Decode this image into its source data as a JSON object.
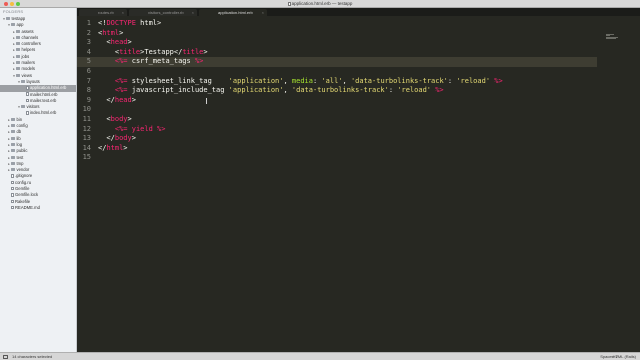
{
  "window": {
    "title": "application.html.erb — testapp"
  },
  "sidebar": {
    "header": "FOLDERS",
    "items": [
      {
        "label": "testapp",
        "depth": 0,
        "type": "folder",
        "expanded": true
      },
      {
        "label": "app",
        "depth": 1,
        "type": "folder",
        "expanded": true
      },
      {
        "label": "assets",
        "depth": 2,
        "type": "folder",
        "expanded": false
      },
      {
        "label": "channels",
        "depth": 2,
        "type": "folder",
        "expanded": false
      },
      {
        "label": "controllers",
        "depth": 2,
        "type": "folder",
        "expanded": false
      },
      {
        "label": "helpers",
        "depth": 2,
        "type": "folder",
        "expanded": false
      },
      {
        "label": "jobs",
        "depth": 2,
        "type": "folder",
        "expanded": false
      },
      {
        "label": "mailers",
        "depth": 2,
        "type": "folder",
        "expanded": false
      },
      {
        "label": "models",
        "depth": 2,
        "type": "folder",
        "expanded": false
      },
      {
        "label": "views",
        "depth": 2,
        "type": "folder",
        "expanded": true
      },
      {
        "label": "layouts",
        "depth": 3,
        "type": "folder",
        "expanded": true
      },
      {
        "label": "application.html.erb",
        "depth": 4,
        "type": "file",
        "selected": true
      },
      {
        "label": "mailer.html.erb",
        "depth": 4,
        "type": "file"
      },
      {
        "label": "mailer.text.erb",
        "depth": 4,
        "type": "file"
      },
      {
        "label": "visitors",
        "depth": 3,
        "type": "folder",
        "expanded": true
      },
      {
        "label": "index.html.erb",
        "depth": 4,
        "type": "file"
      },
      {
        "label": "bin",
        "depth": 1,
        "type": "folder",
        "expanded": false
      },
      {
        "label": "config",
        "depth": 1,
        "type": "folder",
        "expanded": false
      },
      {
        "label": "db",
        "depth": 1,
        "type": "folder",
        "expanded": false
      },
      {
        "label": "lib",
        "depth": 1,
        "type": "folder",
        "expanded": false
      },
      {
        "label": "log",
        "depth": 1,
        "type": "folder",
        "expanded": false
      },
      {
        "label": "public",
        "depth": 1,
        "type": "folder",
        "expanded": false
      },
      {
        "label": "test",
        "depth": 1,
        "type": "folder",
        "expanded": false
      },
      {
        "label": "tmp",
        "depth": 1,
        "type": "folder",
        "expanded": false
      },
      {
        "label": "vendor",
        "depth": 1,
        "type": "folder",
        "expanded": false
      },
      {
        "label": ".gitignore",
        "depth": 1,
        "type": "file"
      },
      {
        "label": "config.ru",
        "depth": 1,
        "type": "file"
      },
      {
        "label": "Gemfile",
        "depth": 1,
        "type": "file"
      },
      {
        "label": "Gemfile.lock",
        "depth": 1,
        "type": "file"
      },
      {
        "label": "Rakefile",
        "depth": 1,
        "type": "file"
      },
      {
        "label": "README.md",
        "depth": 1,
        "type": "file"
      }
    ]
  },
  "tabs": [
    {
      "label": "routes.rb",
      "active": false
    },
    {
      "label": "visitors_controller.rb",
      "active": false
    },
    {
      "label": "application.html.erb",
      "active": true
    }
  ],
  "editor": {
    "current_line": 5,
    "lines": [
      [
        [
          "pu",
          "<!"
        ],
        [
          "tg",
          "DOCTYPE"
        ],
        [
          "pu",
          " html>"
        ]
      ],
      [
        [
          "pu",
          "<"
        ],
        [
          "tg",
          "html"
        ],
        [
          "pu",
          ">"
        ]
      ],
      [
        [
          "pu",
          "  <"
        ],
        [
          "tg",
          "head"
        ],
        [
          "pu",
          ">"
        ]
      ],
      [
        [
          "pu",
          "    <"
        ],
        [
          "tg",
          "title"
        ],
        [
          "pu",
          ">Testapp</"
        ],
        [
          "tg",
          "title"
        ],
        [
          "pu",
          ">"
        ]
      ],
      [
        [
          "pu",
          "    "
        ],
        [
          "tg",
          "<%="
        ],
        [
          "pu",
          " csrf_meta_tags "
        ],
        [
          "tg",
          "%>"
        ]
      ],
      [],
      [
        [
          "pu",
          "    "
        ],
        [
          "tg",
          "<%="
        ],
        [
          "pu",
          " stylesheet_link_tag    "
        ],
        [
          "st",
          "'application'"
        ],
        [
          "pu",
          ", "
        ],
        [
          "kw",
          "media"
        ],
        [
          "pu",
          ": "
        ],
        [
          "st",
          "'all'"
        ],
        [
          "pu",
          ", "
        ],
        [
          "st",
          "'data-turbolinks-track'"
        ],
        [
          "pu",
          ": "
        ],
        [
          "st",
          "'reload'"
        ],
        [
          "pu",
          " "
        ],
        [
          "tg",
          "%>"
        ]
      ],
      [
        [
          "pu",
          "    "
        ],
        [
          "tg",
          "<%="
        ],
        [
          "pu",
          " javascript_include_tag "
        ],
        [
          "st",
          "'application'"
        ],
        [
          "pu",
          ", "
        ],
        [
          "st",
          "'data-turbolinks-track'"
        ],
        [
          "pu",
          ": "
        ],
        [
          "st",
          "'reload'"
        ],
        [
          "pu",
          " "
        ],
        [
          "tg",
          "%>"
        ]
      ],
      [
        [
          "pu",
          "  </"
        ],
        [
          "tg",
          "head"
        ],
        [
          "pu",
          ">"
        ]
      ],
      [],
      [
        [
          "pu",
          "  <"
        ],
        [
          "tg",
          "body"
        ],
        [
          "pu",
          ">"
        ]
      ],
      [
        [
          "pu",
          "    "
        ],
        [
          "tg",
          "<%="
        ],
        [
          "pu",
          " "
        ],
        [
          "tg",
          "yield"
        ],
        [
          "pu",
          " "
        ],
        [
          "tg",
          "%>"
        ]
      ],
      [
        [
          "pu",
          "  </"
        ],
        [
          "tg",
          "body"
        ],
        [
          "pu",
          ">"
        ]
      ],
      [
        [
          "pu",
          "</"
        ],
        [
          "tg",
          "html"
        ],
        [
          "pu",
          ">"
        ]
      ],
      []
    ]
  },
  "statusbar": {
    "left": "14 characters selected",
    "spaces": "Spaces: 2",
    "syntax": "HTML (Rails)"
  },
  "colors": {
    "editor_bg": "#272822",
    "tag": "#f92672",
    "string": "#e6db74",
    "keyword": "#a6e22e",
    "text": "#f8f8f2"
  }
}
